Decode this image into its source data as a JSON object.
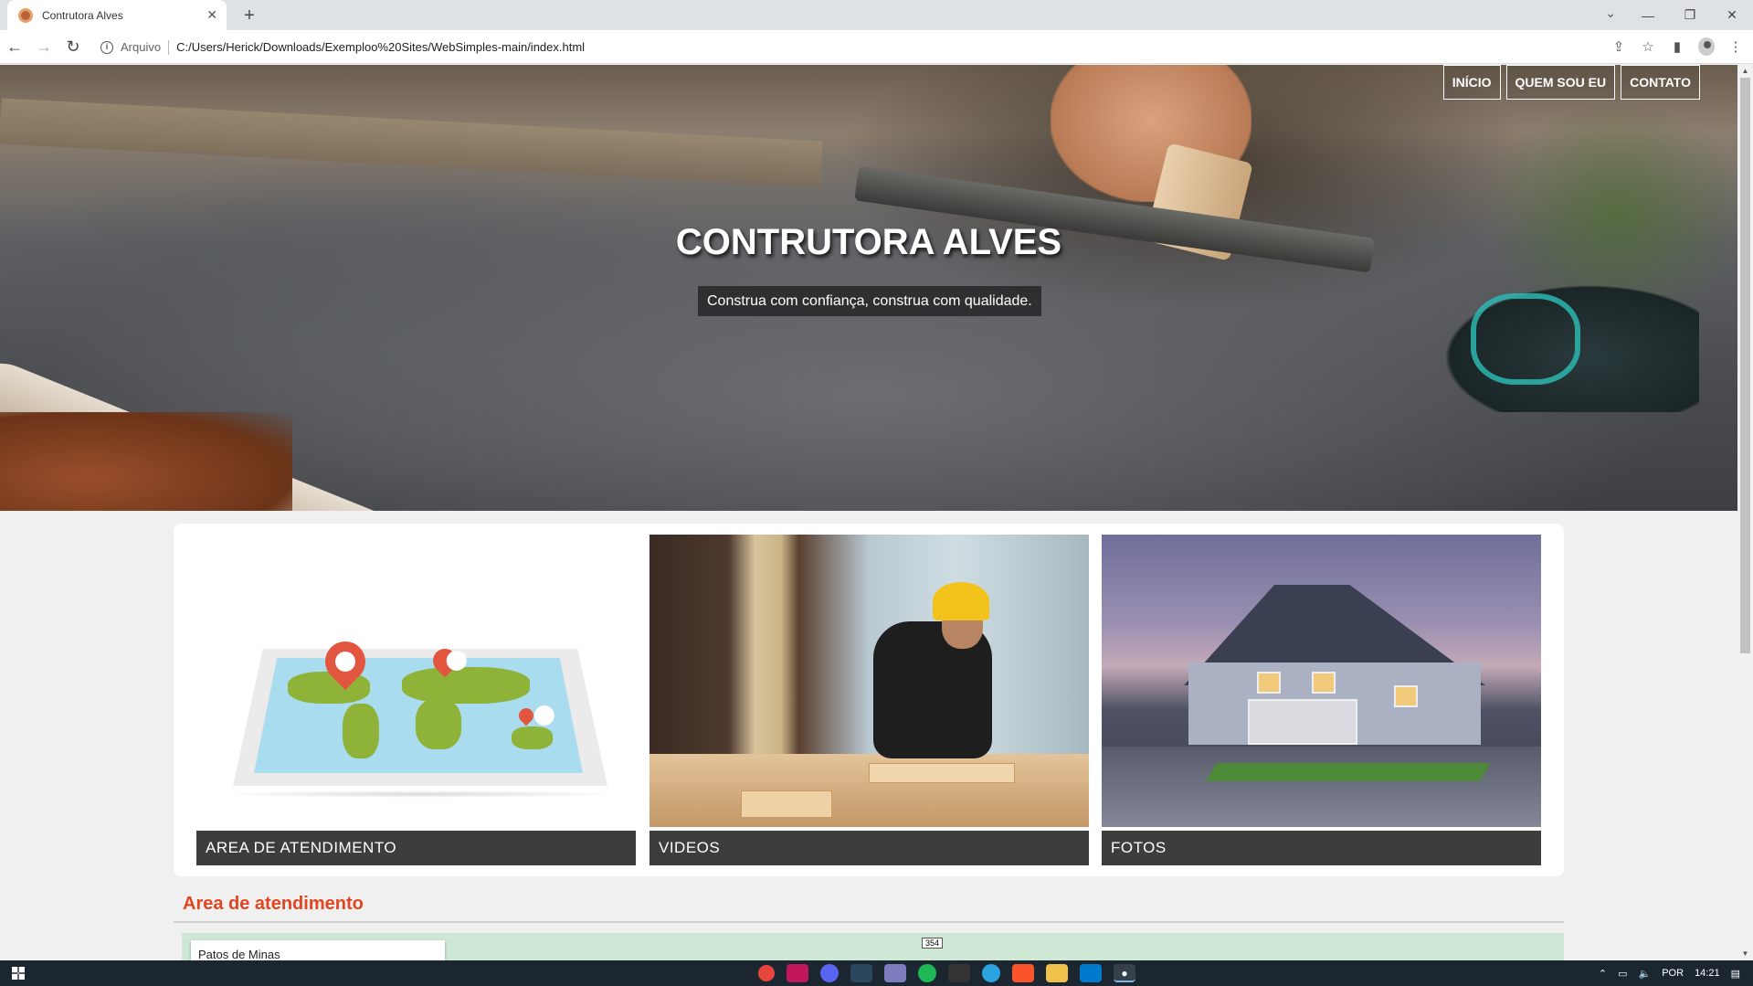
{
  "browser": {
    "tab_title": "Contrutora Alves",
    "new_tab_symbol": "+",
    "address_scheme_label": "Arquivo",
    "url": "C:/Users/Herick/Downloads/Exemploo%20Sites/WebSimples-main/index.html",
    "window_controls": [
      "⌄",
      "—",
      "❐",
      "✕"
    ]
  },
  "nav": {
    "items": [
      "INÍCIO",
      "QUEM SOU EU",
      "CONTATO"
    ]
  },
  "hero": {
    "title": "CONTRUTORA ALVES",
    "subtitle": "Construa com confiança, construa com qualidade."
  },
  "cards": [
    {
      "caption": "AREA DE ATENDIMENTO",
      "icon": "world-map-with-pins"
    },
    {
      "caption": "VIDEOS",
      "icon": "construction-worker-photo"
    },
    {
      "caption": "FOTOS",
      "icon": "house-photo"
    }
  ],
  "section": {
    "title": "Area de atendimento",
    "map_search_value": "Patos de Minas",
    "map_road_label": "354"
  },
  "taskbar": {
    "language": "POR",
    "time": "14:21"
  },
  "colors": {
    "accent": "#e2451f",
    "caption_bg": "#3d3d3d",
    "taskbar_bg": "#1b2631"
  }
}
